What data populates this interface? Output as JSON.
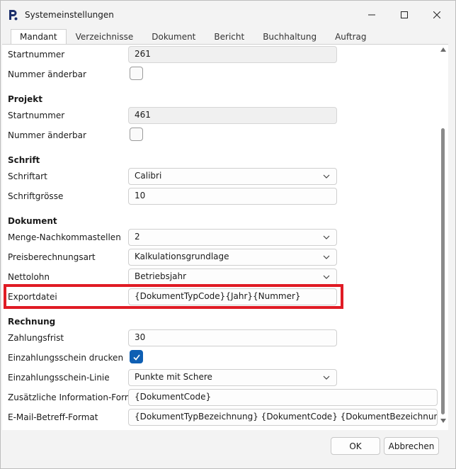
{
  "window": {
    "title": "Systemeinstellungen"
  },
  "tabs": [
    "Mandant",
    "Verzeichnisse",
    "Dokument",
    "Bericht",
    "Buchhaltung",
    "Auftrag"
  ],
  "rows": {
    "r1": {
      "label": "Startnummer",
      "value": "261"
    },
    "r2": {
      "label": "Nummer änderbar"
    },
    "projekt": {
      "title": "Projekt"
    },
    "r3": {
      "label": "Startnummer",
      "value": "461"
    },
    "r4": {
      "label": "Nummer änderbar"
    },
    "schrift": {
      "title": "Schrift"
    },
    "r5": {
      "label": "Schriftart",
      "value": "Calibri"
    },
    "r6": {
      "label": "Schriftgrösse",
      "value": "10"
    },
    "dokument": {
      "title": "Dokument"
    },
    "r7": {
      "label": "Menge-Nachkommastellen",
      "value": "2"
    },
    "r8": {
      "label": "Preisberechnungsart",
      "value": "Kalkulationsgrundlage"
    },
    "r9": {
      "label": "Nettolohn",
      "value": "Betriebsjahr"
    },
    "r10": {
      "label": "Exportdatei",
      "value": "{DokumentTypCode}{Jahr}{Nummer}"
    },
    "rechnung": {
      "title": "Rechnung"
    },
    "r11": {
      "label": "Zahlungsfrist",
      "value": "30"
    },
    "r12": {
      "label": "Einzahlungsschein drucken"
    },
    "r13": {
      "label": "Einzahlungsschein-Linie",
      "value": "Punkte mit Schere"
    },
    "r14": {
      "label": "Zusätzliche Information-Format",
      "value": "{DokumentCode}"
    },
    "r15": {
      "label": "E-Mail-Betreff-Format",
      "value": "{DokumentTypBezeichnung} {DokumentCode} {DokumentBezeichnung}"
    }
  },
  "buttons": {
    "ok": "OK",
    "cancel": "Abbrechen"
  },
  "colors": {
    "accent": "#0f5fb3",
    "highlight": "#e01b24"
  }
}
